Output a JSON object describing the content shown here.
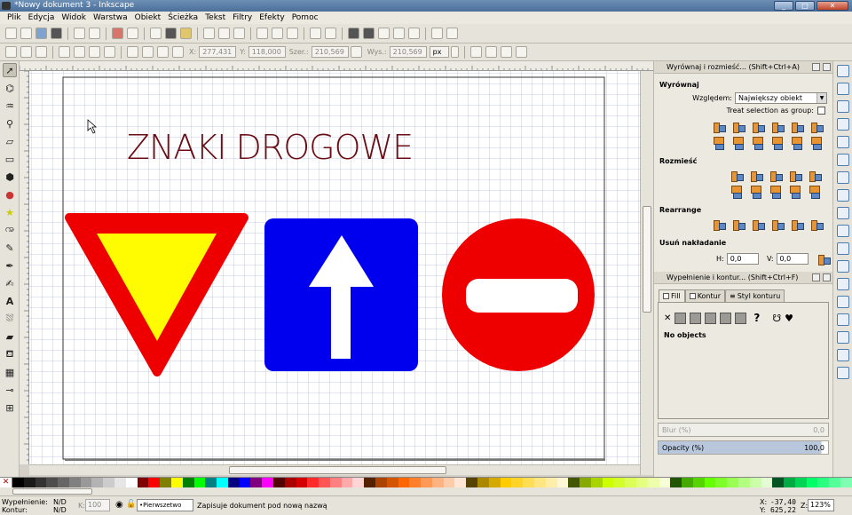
{
  "window": {
    "title": "*Nowy dokument 3 - Inkscape"
  },
  "menu": [
    "Plik",
    "Edycja",
    "Widok",
    "Warstwa",
    "Obiekt",
    "Ścieżka",
    "Tekst",
    "Filtry",
    "Efekty",
    "Pomoc"
  ],
  "select_toolbar": {
    "x_label": "X:",
    "x_value": "277,431",
    "y_label": "Y:",
    "y_value": "118,000",
    "w_label": "Szer.:",
    "w_value": "210,569",
    "h_label": "Wys.:",
    "h_value": "210,569",
    "unit": "px"
  },
  "canvas": {
    "title": "ZNAKI DROGOWE",
    "title_color": "#6b0d14",
    "colors": {
      "red": "#ee0000",
      "yellow": "#fffb00",
      "blue": "#0000ee",
      "white": "#ffffff",
      "grid": "#9aa6dd"
    }
  },
  "align_panel": {
    "title": "Wyrównaj i rozmieść... (Shift+Ctrl+A)",
    "section_align": "Wyrównaj",
    "relative_label": "Względem:",
    "relative_value": "Największy obiekt",
    "treat_group": "Treat selection as group:",
    "section_distribute": "Rozmieść",
    "section_rearrange": "Rearrange",
    "section_overlap": "Usuń nakładanie",
    "h_label": "H:",
    "h_value": "0,0",
    "v_label": "V:",
    "v_value": "0,0"
  },
  "fill_panel": {
    "title": "Wypełnienie i kontur... (Shift+Ctrl+F)",
    "tab_fill": "Fill",
    "tab_stroke": "Kontur",
    "tab_stroke_style": "Styl konturu",
    "no_objects": "No objects",
    "blur_label": "Blur (%)",
    "blur_value": "0,0",
    "opacity_label": "Opacity (%)",
    "opacity_value": "100,0"
  },
  "palette": [
    "#000000",
    "#1a1a1a",
    "#333333",
    "#4d4d4d",
    "#666666",
    "#808080",
    "#999999",
    "#b3b3b3",
    "#cccccc",
    "#e6e6e6",
    "#ffffff",
    "#800000",
    "#ff0000",
    "#808000",
    "#ffff00",
    "#008000",
    "#00ff00",
    "#008080",
    "#00ffff",
    "#000080",
    "#0000ff",
    "#800080",
    "#ff00ff",
    "#550000",
    "#aa0000",
    "#d40000",
    "#ff2a2a",
    "#ff5555",
    "#ff8080",
    "#ffaaaa",
    "#ffd5d5",
    "#552200",
    "#aa4400",
    "#d45500",
    "#ff6600",
    "#ff7f2a",
    "#ff9955",
    "#ffb380",
    "#ffccaa",
    "#ffe6d5",
    "#554400",
    "#aa8800",
    "#d4aa00",
    "#ffcc00",
    "#ffd42a",
    "#ffdd55",
    "#ffe680",
    "#ffeeaa",
    "#fff6d5",
    "#445500",
    "#88aa00",
    "#aad400",
    "#ccff00",
    "#d4ff2a",
    "#ddff55",
    "#e5ff80",
    "#eeffaa",
    "#f6ffd5",
    "#225500",
    "#44aa00",
    "#55d400",
    "#66ff00",
    "#7fff2a",
    "#99ff55",
    "#b3ff80",
    "#ccffaa",
    "#e5ffd5",
    "#005522",
    "#00aa44",
    "#00d455",
    "#00ff66",
    "#2aff80",
    "#55ff99",
    "#80ffb3"
  ],
  "status": {
    "fill_label": "Wypełnienie:",
    "fill_value": "N/D",
    "stroke_label": "Kontur:",
    "stroke_value": "N/D",
    "opacity_label": "K:",
    "opacity_value": "100",
    "layer": "•Pierwszetwo",
    "message": "Zapisuje dokument pod nową nazwą",
    "x_label": "X:",
    "x_value": "-37,40",
    "y_label": "Y:",
    "y_value": "625,22",
    "zoom_label": "Z:",
    "zoom_value": "123%"
  }
}
